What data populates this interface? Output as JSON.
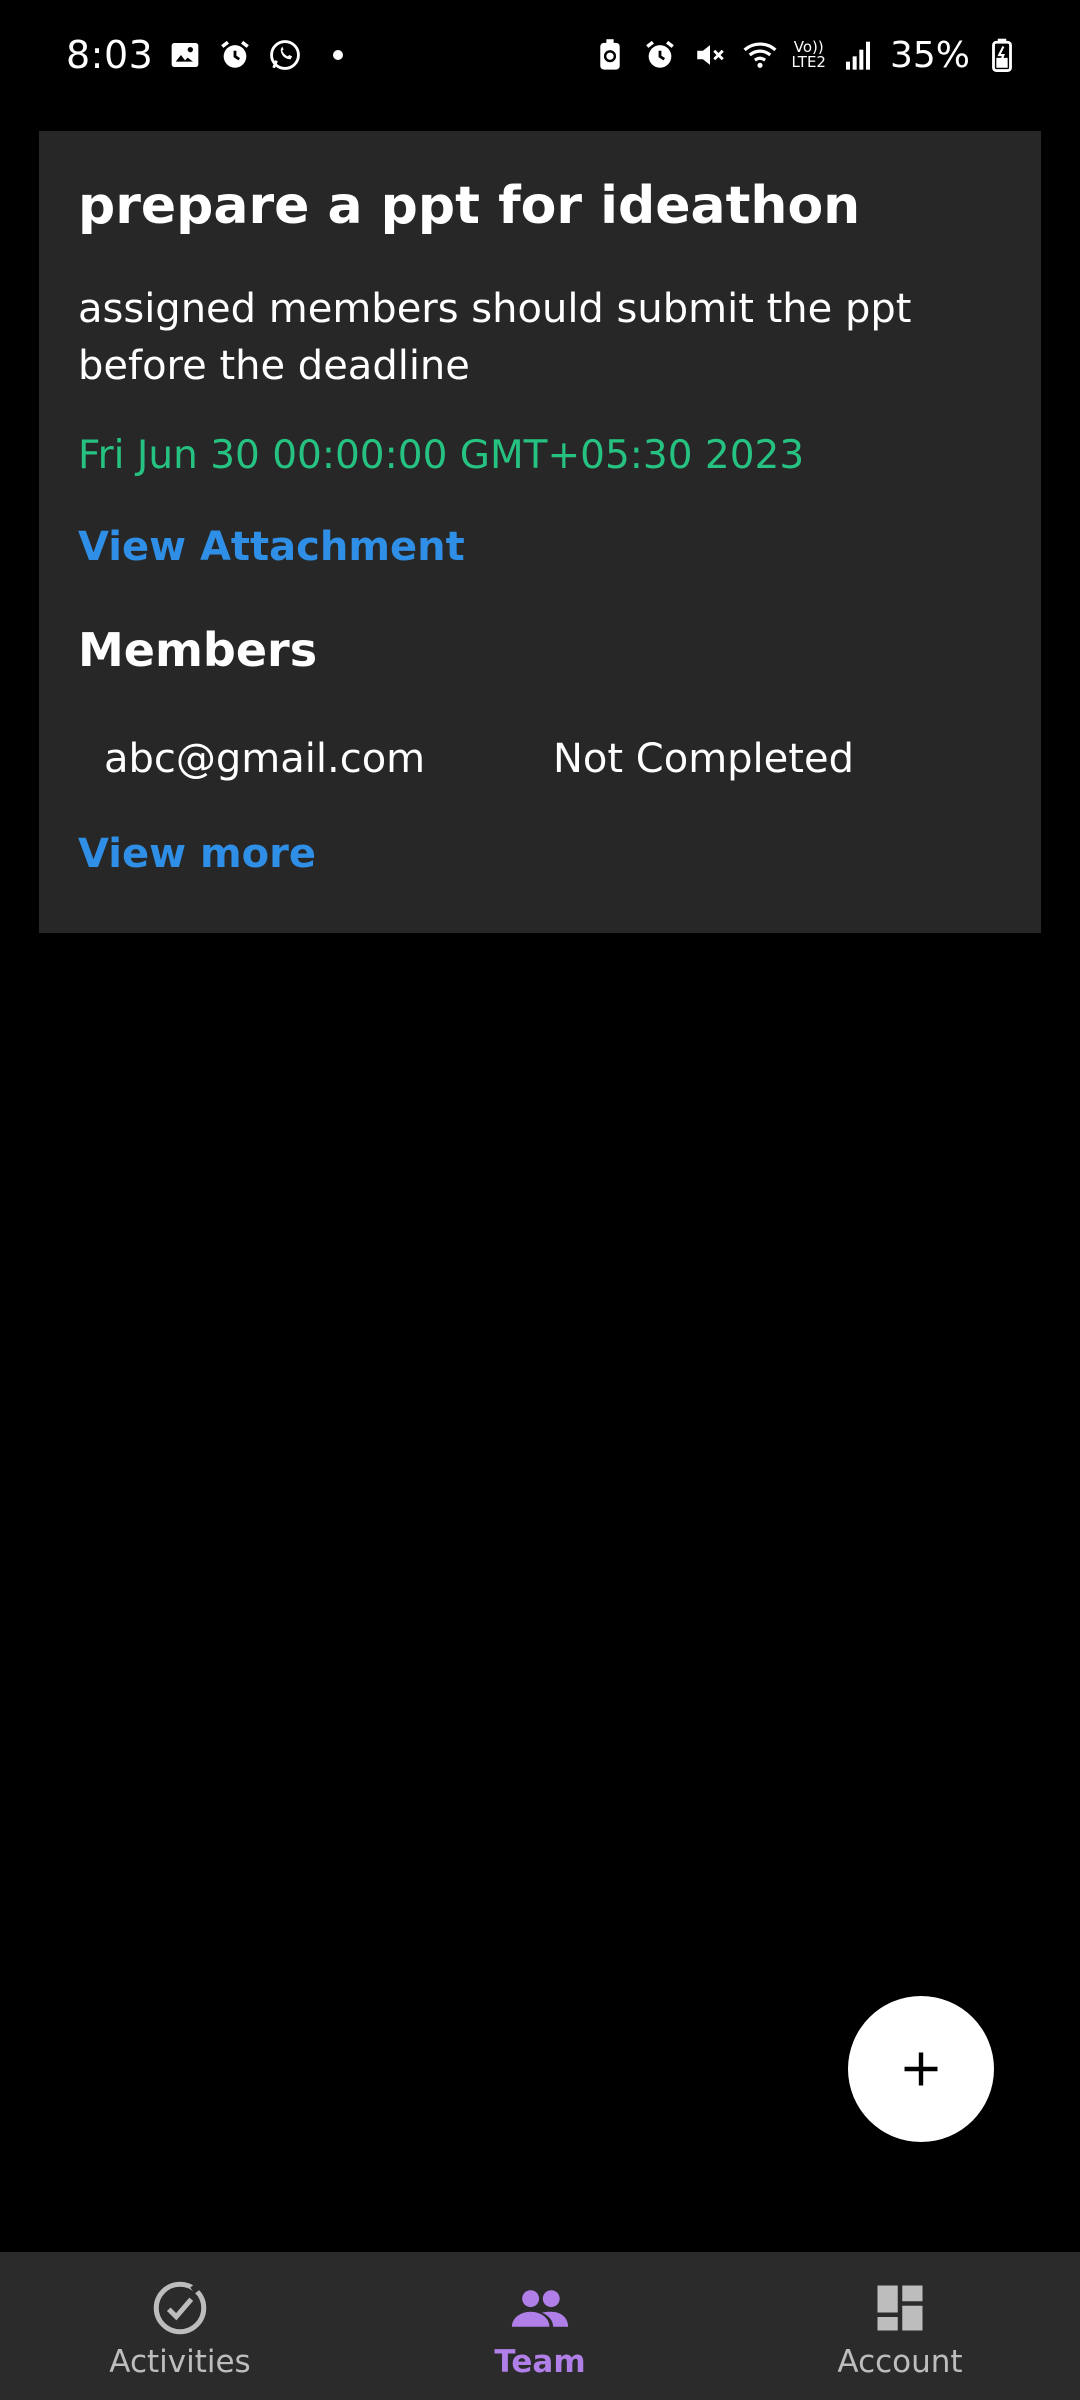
{
  "status_bar": {
    "time": "8:03",
    "battery": "35%",
    "network_top": "Vo))",
    "network_bottom": "LTE2",
    "icons_left": [
      "gallery-icon",
      "alarm-icon",
      "whatsapp-icon",
      "dot-icon"
    ],
    "icons_right": [
      "battery-saver-icon",
      "alarm-icon",
      "mute-icon",
      "wifi-icon",
      "signal-icon",
      "battery-icon"
    ]
  },
  "task": {
    "title": "prepare a ppt for ideathon",
    "description": "assigned members should submit the ppt before the deadline",
    "deadline": "Fri Jun 30 00:00:00 GMT+05:30 2023",
    "attachment_label": "View Attachment",
    "members_heading": "Members",
    "members": [
      {
        "email": "abc@gmail.com",
        "status": "Not Completed"
      }
    ],
    "view_more_label": "View more"
  },
  "fab": {
    "icon": "plus-icon"
  },
  "bottom_nav": {
    "items": [
      {
        "label": "Activities",
        "icon": "check-circle-icon",
        "active": false
      },
      {
        "label": "Team",
        "icon": "people-icon",
        "active": true
      },
      {
        "label": "Account",
        "icon": "dashboard-icon",
        "active": false
      }
    ]
  },
  "colors": {
    "background": "#000000",
    "card": "#272727",
    "date_green": "#26c281",
    "link_blue": "#2f8fe6",
    "nav_active": "#b07fe8",
    "nav_bg": "#2b2b2b"
  }
}
